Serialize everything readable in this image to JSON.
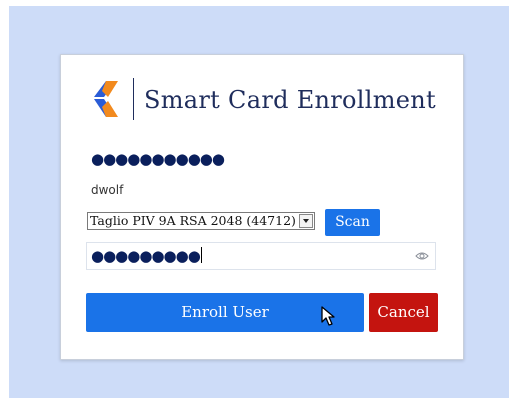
{
  "dialog": {
    "title": "Smart Card Enrollment",
    "masked_field": "●●●●●●●●●●●",
    "username": "dwolf",
    "card_select": {
      "selected": "Taglio PIV 9A RSA 2048 (44712)"
    },
    "scan_label": "Scan",
    "pin_field": {
      "value": "●●●●●●●●●"
    },
    "enroll_label": "Enroll User",
    "cancel_label": "Cancel"
  },
  "icons": {
    "logo": "brand-logo-icon",
    "eye": "eye-icon",
    "cursor": "mouse-pointer-icon"
  },
  "colors": {
    "backdrop": "#cddcf8",
    "title": "#1f2d5c",
    "primary": "#1a73e8",
    "danger": "#c4140f",
    "logo_orange": "#f28a1e",
    "logo_blue": "#2a5cd6"
  }
}
